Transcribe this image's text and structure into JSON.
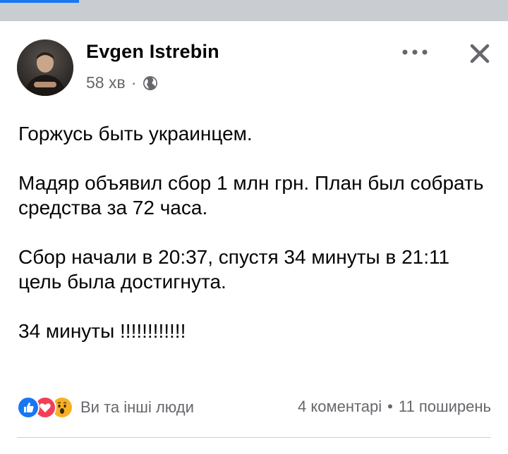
{
  "post": {
    "author": "Evgen Istrebin",
    "time": "58 хв",
    "separator": "·",
    "visibility_icon": "globe-icon",
    "paragraphs": [
      "Горжусь быть украинцем.",
      "Мадяр объявил сбор 1 млн грн. План был собрать средства за 72 часа.",
      "Сбор начали в 20:37, спустя 34 минуты в 21:11 цель была достигнута.",
      "34 минуты !!!!!!!!!!!!"
    ]
  },
  "header_actions": {
    "more_icon": "more-horizontal-icon",
    "close_icon": "close-icon"
  },
  "footer": {
    "reaction_icons": [
      "like-icon",
      "love-icon",
      "wow-icon"
    ],
    "reactions_label": "Ви та інші люди",
    "comments": "4 коментарі",
    "dot": "•",
    "shares": "11 поширень"
  },
  "colors": {
    "accent": "#1877f2",
    "love": "#f33e58",
    "wow": "#f7b125",
    "secondary_text": "#65676b",
    "top_strip": "#c9ccd1"
  }
}
